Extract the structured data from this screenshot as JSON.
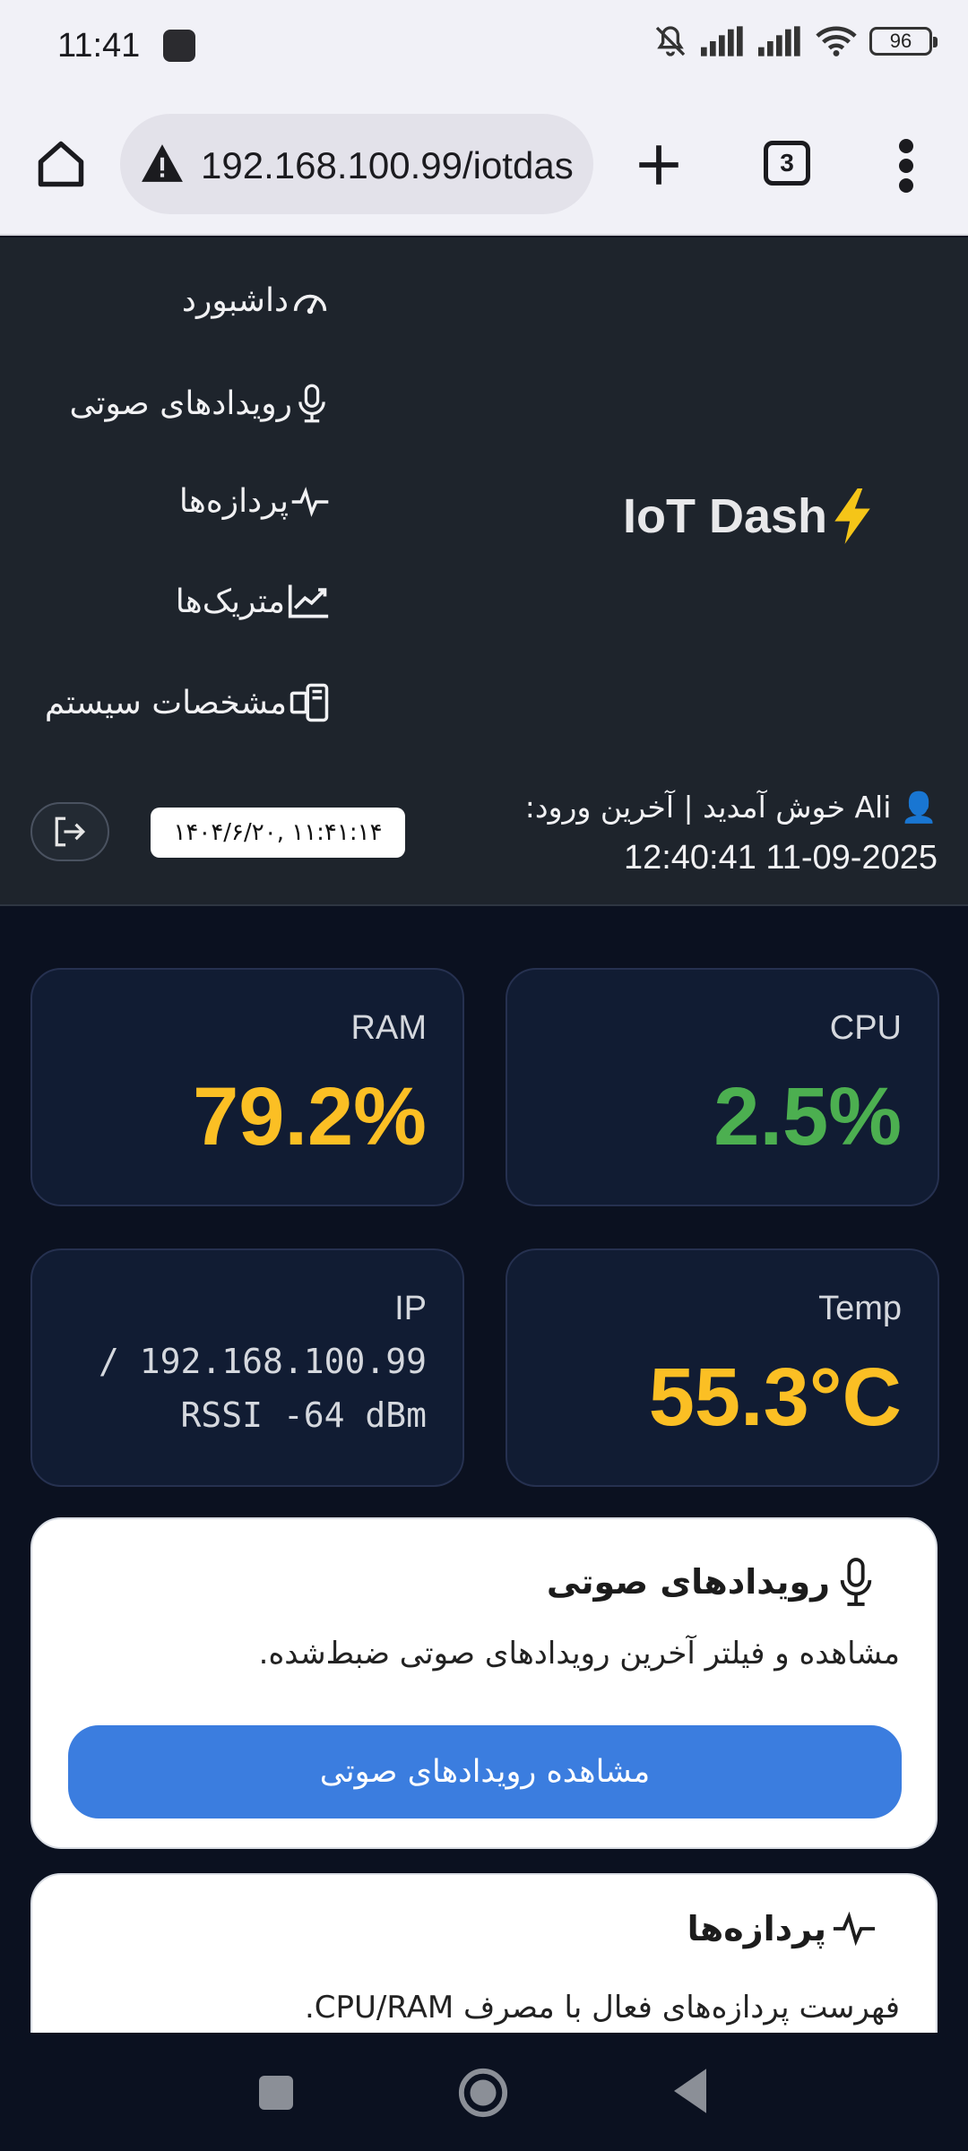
{
  "status_bar": {
    "time": "11:41",
    "battery": "96",
    "icons": [
      "notifications-muted-icon",
      "signal-icon",
      "signal-icon",
      "wifi-icon",
      "battery-icon"
    ]
  },
  "browser": {
    "url": "192.168.100.99/iotdas",
    "tab_count": "3",
    "icons": [
      "home-icon",
      "warning-icon",
      "plus-icon",
      "tabs-icon",
      "more-vert-icon"
    ]
  },
  "header": {
    "brand": "IoT Dash",
    "brand_icon": "lightning-icon",
    "nav": [
      {
        "label": "داشبورد",
        "icon": "gauge-icon"
      },
      {
        "label": "رویدادهای صوتی",
        "icon": "microphone-icon"
      },
      {
        "label": "پردازه‌ها",
        "icon": "pulse-icon"
      },
      {
        "label": "متریک‌ها",
        "icon": "chart-line-icon"
      },
      {
        "label": "مشخصات سیستم",
        "icon": "devices-icon"
      }
    ],
    "welcome_line1": "👤 Ali خوش آمدید | آخرین ورود:",
    "welcome_line2": "12:40:41 11-09-2025",
    "clock": "۱۴۰۴/۶/۲۰, ۱۱:۴۱:۱۴"
  },
  "stats": {
    "cpu": {
      "label": "CPU",
      "value": "2.5%",
      "color": "#4caf50"
    },
    "ram": {
      "label": "RAM",
      "value": "79.2%",
      "color": "#fbbf24"
    },
    "temp": {
      "label": "Temp",
      "value": "55.3°C",
      "color": "#fbbf24"
    },
    "ip": {
      "label": "IP",
      "line1": "/ 192.168.100.99",
      "line2": "RSSI -64 dBm"
    }
  },
  "cards": {
    "audio": {
      "title": "رویدادهای صوتی",
      "description": "مشاهده و فیلتر آخرین رویدادهای صوتی ضبط‌شده.",
      "button": "مشاهده رویدادهای صوتی"
    },
    "processes": {
      "title": "پردازه‌ها",
      "description": "فهرست پردازه‌های فعال با مصرف CPU/RAM."
    }
  },
  "colors": {
    "accent_blue": "#3b7ddf",
    "header_bg": "#1e242c",
    "page_bg": "#0b1120"
  }
}
